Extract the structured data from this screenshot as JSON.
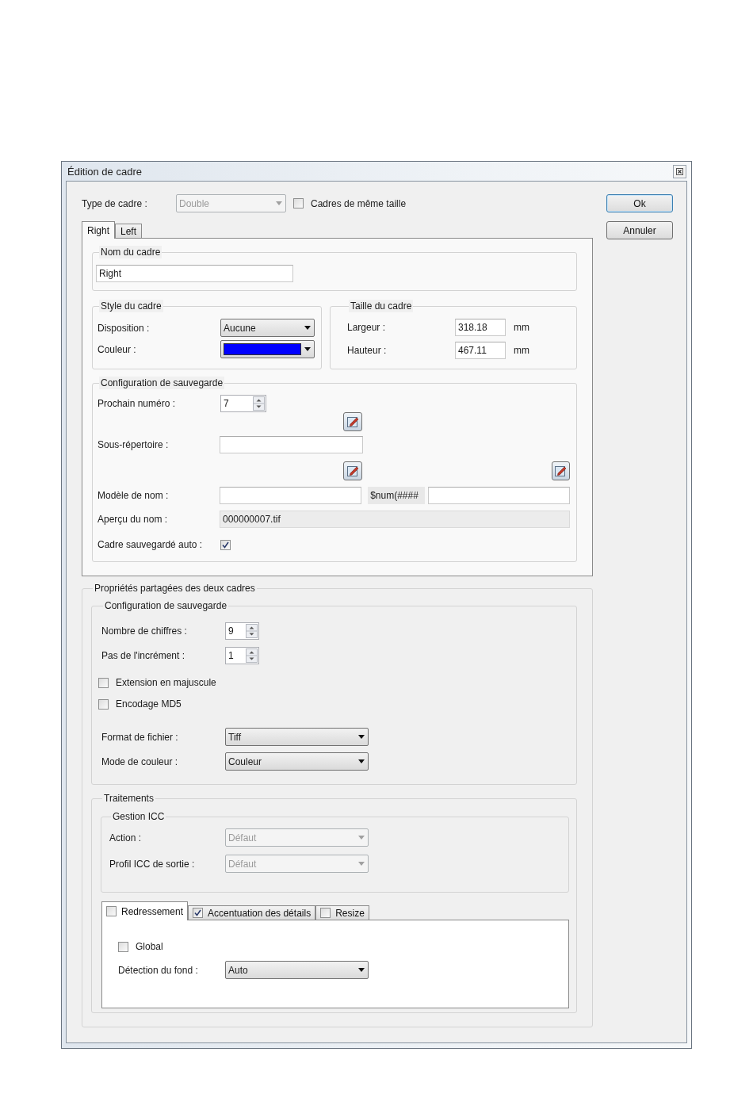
{
  "window": {
    "title": "Édition de cadre"
  },
  "frame_type": {
    "label": "Type de cadre :",
    "value": "Double",
    "disabled": true
  },
  "same_size": {
    "label": "Cadres de même taille",
    "checked": false
  },
  "buttons": [
    {
      "label": "Ok",
      "default": true
    },
    {
      "label": "Annuler",
      "default": false
    }
  ],
  "frame_tabs": [
    {
      "label": "Right",
      "selected": true
    },
    {
      "label": "Left",
      "selected": false
    }
  ],
  "frame_name": {
    "title": "Nom du cadre",
    "value": "Right"
  },
  "frame_style": {
    "title": "Style du cadre",
    "layout": {
      "label": "Disposition :",
      "value": "Aucune"
    },
    "color": {
      "label": "Couleur :",
      "color": "#0000ff"
    }
  },
  "frame_size": {
    "title": "Taille du cadre",
    "fields": [
      {
        "label": "Largeur :",
        "value": "318.18",
        "unit": "mm"
      },
      {
        "label": "Hauteur :",
        "value": "467.11",
        "unit": "mm"
      }
    ]
  },
  "save_config": {
    "title": "Configuration de sauvegarde",
    "next_number": {
      "label": "Prochain numéro :",
      "value": "7"
    },
    "subfolder": {
      "label": "Sous-répertoire :"
    },
    "name_pattern": {
      "label": "Modèle de nom :",
      "token": "$num(####"
    },
    "name_preview": {
      "label": "Aperçu du nom :",
      "value": "000000007.tif"
    },
    "auto_save": {
      "label": "Cadre sauvegardé auto :",
      "checked": true
    }
  },
  "shared": {
    "title": "Propriétés partagées des deux cadres",
    "save_config": {
      "title": "Configuration de sauvegarde",
      "digits": {
        "label": "Nombre de chiffres :",
        "value": "9"
      },
      "increment": {
        "label": "Pas de l'incrément :",
        "value": "1"
      },
      "options": [
        {
          "label": "Extension en majuscule",
          "checked": false
        },
        {
          "label": "Encodage MD5",
          "checked": false
        }
      ],
      "file_format": {
        "label": "Format de fichier :",
        "value": "Tiff"
      },
      "color_mode": {
        "label": "Mode de couleur :",
        "value": "Couleur"
      }
    },
    "processing": {
      "title": "Traitements",
      "icc": {
        "title": "Gestion ICC",
        "fields": [
          {
            "label": "Action :",
            "value": "Défaut",
            "disabled": true
          },
          {
            "label": "Profil ICC de sortie :",
            "value": "Défaut",
            "disabled": true
          }
        ]
      },
      "tabs": [
        {
          "label": "Redressement",
          "checked": false,
          "selected": true
        },
        {
          "label": "Accentuation des détails",
          "checked": true,
          "selected": false
        },
        {
          "label": "Resize",
          "checked": false,
          "selected": false
        }
      ],
      "global": {
        "label": "Global",
        "checked": false
      },
      "background_detection": {
        "label": "Détection du fond :",
        "value": "Auto"
      }
    }
  }
}
